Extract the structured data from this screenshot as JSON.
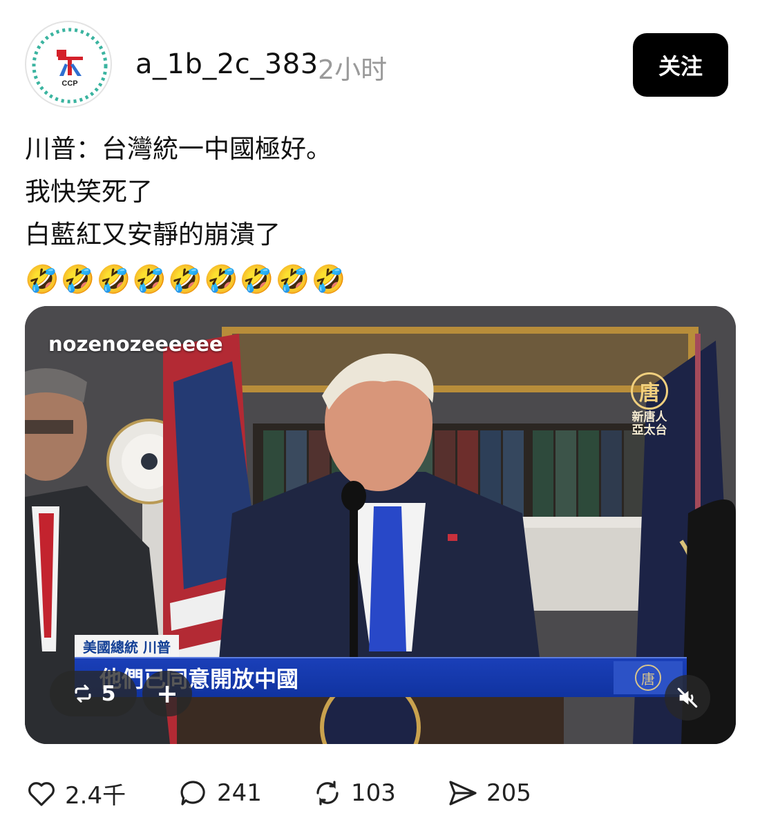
{
  "post": {
    "username": "a_1b_2c_383",
    "time": "2小时",
    "follow_label": "关注",
    "avatar_label": "CCP",
    "lines": [
      "川普：台灣統一中國極好。",
      "我快笑死了",
      "白藍紅又安靜的崩潰了"
    ],
    "emojis": "🤣🤣🤣🤣🤣🤣🤣🤣🤣"
  },
  "video": {
    "watermark": "nozenozeeeeee",
    "ntd_logo_char": "唐",
    "ntd_logo_text": "新唐人 亞太台",
    "caption_tag": "美國總統 川普",
    "caption_text": "他們已同意開放中國",
    "repost_count": "5",
    "plus_label": "+"
  },
  "actions": {
    "likes": "2.4千",
    "comments": "241",
    "reposts": "103",
    "shares": "205"
  }
}
